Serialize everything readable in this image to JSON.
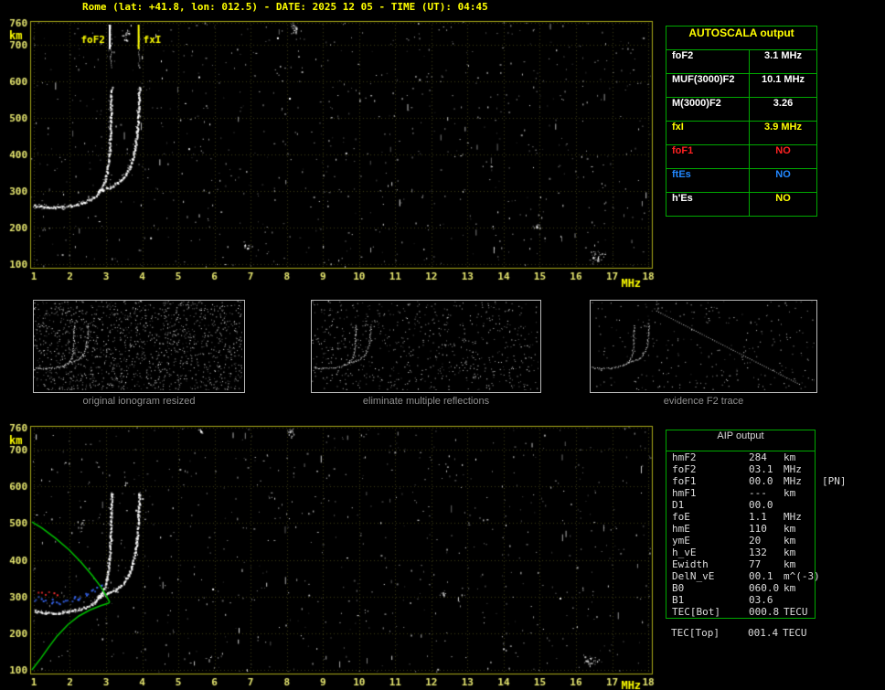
{
  "title": "Rome (lat: +41.8, lon: 012.5) - DATE: 2025 12 05 - TIME (UT): 04:45",
  "colors": {
    "accent_yellow": "#ffff00",
    "table_green": "#00a800",
    "caption_gray": "#8f8f8f",
    "status_no_red": "#ff2222",
    "status_no_blue": "#2288ff"
  },
  "autoscala": {
    "title": "AUTOSCALA output",
    "rows": [
      {
        "param": "foF2",
        "value": "3.1 MHz",
        "param_color": "#ffffff",
        "value_color": "#ffffff"
      },
      {
        "param": "MUF(3000)F2",
        "value": "10.1 MHz",
        "param_color": "#ffffff",
        "value_color": "#ffffff"
      },
      {
        "param": "M(3000)F2",
        "value": "3.26",
        "param_color": "#ffffff",
        "value_color": "#ffffff"
      },
      {
        "param": "fxI",
        "value": "3.9 MHz",
        "param_color": "#ffff00",
        "value_color": "#ffff00"
      },
      {
        "param": "foF1",
        "value": "NO",
        "param_color": "#ff2222",
        "value_color": "#ff2222"
      },
      {
        "param": "ftEs",
        "value": "NO",
        "param_color": "#2288ff",
        "value_color": "#2288ff"
      },
      {
        "param": "h'Es",
        "value": "NO",
        "param_color": "#ffffff",
        "value_color": "#ffff00"
      }
    ]
  },
  "aip": {
    "title": "AIP output",
    "rows": [
      {
        "param": "hmF2",
        "value": "284",
        "unit": "km",
        "note": ""
      },
      {
        "param": "foF2",
        "value": "03.1",
        "unit": "MHz",
        "note": ""
      },
      {
        "param": "foF1",
        "value": "00.0",
        "unit": "MHz",
        "note": "[PN]"
      },
      {
        "param": "hmF1",
        "value": "---",
        "unit": "km",
        "note": ""
      },
      {
        "param": "D1",
        "value": "00.0",
        "unit": "",
        "note": ""
      },
      {
        "param": "foE",
        "value": "1.1",
        "unit": "MHz",
        "note": ""
      },
      {
        "param": "hmE",
        "value": "110",
        "unit": "km",
        "note": ""
      },
      {
        "param": "ymE",
        "value": "20",
        "unit": "km",
        "note": ""
      },
      {
        "param": "h_vE",
        "value": "132",
        "unit": "km",
        "note": ""
      },
      {
        "param": "Ewidth",
        "value": "77",
        "unit": "km",
        "note": ""
      },
      {
        "param": "DelN_vE",
        "value": "00.1",
        "unit": "m^(-3)",
        "note": ""
      },
      {
        "param": "B0",
        "value": "060.0",
        "unit": "km",
        "note": ""
      },
      {
        "param": "B1",
        "value": "03.6",
        "unit": "",
        "note": ""
      },
      {
        "param": "TEC[Bot]",
        "value": "000.8",
        "unit": "TECU",
        "note": ""
      },
      {
        "param": "TEC[Top]",
        "value": "001.4",
        "unit": "TECU",
        "note": ""
      }
    ]
  },
  "thumbnails": {
    "captions": [
      "original ionogram resized",
      "eliminate multiple reflections",
      "evidence F2 trace"
    ],
    "xlim": [
      0.9,
      12.5
    ],
    "ylim": [
      90,
      765
    ],
    "items": [
      {
        "seed": 11,
        "noise": 1500,
        "diagonal": false
      },
      {
        "seed": 22,
        "noise": 720,
        "diagonal": false
      },
      {
        "seed": 33,
        "noise": 300,
        "diagonal": true
      }
    ],
    "diagonal": [
      [
        4.3,
        690
      ],
      [
        11.8,
        130
      ]
    ]
  },
  "chart_data": [
    {
      "type": "scatter",
      "name": "main-ionogram",
      "title": "recorded ionogram with autoscaled trace",
      "xlabel": "MHz",
      "ylabel": "km",
      "xlim": [
        0.9,
        18.1
      ],
      "ylim": [
        90,
        765
      ],
      "x_ticks": [
        1,
        2,
        3,
        4,
        5,
        6,
        7,
        8,
        9,
        10,
        11,
        12,
        13,
        14,
        15,
        16,
        17,
        18
      ],
      "y_ticks": [
        100,
        200,
        300,
        400,
        500,
        600,
        700,
        760
      ],
      "grid": true,
      "border_color": "#a8a818",
      "grid_color": "#3c3c14",
      "tick_color": "#e8e870",
      "axis_label_color": "#ffff00",
      "markers": [
        {
          "label": "foF2",
          "freq": 3.1,
          "line_color": "#ffffff",
          "label_color": "#ffff00",
          "side": "left"
        },
        {
          "label": "fxI",
          "freq": 3.9,
          "line_color": "#ffff00",
          "label_color": "#ffff00",
          "side": "right"
        }
      ],
      "series": [
        {
          "name": "F2-ordinary-trace",
          "style": "trace",
          "color": "#ffffff",
          "points": [
            [
              1.0,
              262
            ],
            [
              1.2,
              258
            ],
            [
              1.45,
              256
            ],
            [
              1.7,
              257
            ],
            [
              1.95,
              260
            ],
            [
              2.2,
              265
            ],
            [
              2.45,
              273
            ],
            [
              2.65,
              284
            ],
            [
              2.8,
              298
            ],
            [
              2.92,
              318
            ],
            [
              3.0,
              345
            ],
            [
              3.05,
              378
            ],
            [
              3.09,
              420
            ],
            [
              3.11,
              468
            ],
            [
              3.12,
              515
            ],
            [
              3.13,
              558
            ],
            [
              3.14,
              588
            ]
          ]
        },
        {
          "name": "F2-extraordinary-trace",
          "style": "trace",
          "color": "#ffffff",
          "points": [
            [
              2.75,
              300
            ],
            [
              2.95,
              306
            ],
            [
              3.15,
              314
            ],
            [
              3.35,
              326
            ],
            [
              3.5,
              341
            ],
            [
              3.62,
              362
            ],
            [
              3.72,
              390
            ],
            [
              3.8,
              426
            ],
            [
              3.85,
              468
            ],
            [
              3.88,
              515
            ],
            [
              3.9,
              558
            ],
            [
              3.91,
              588
            ]
          ]
        },
        {
          "name": "o-mode-spread",
          "style": "vdots",
          "color": "#dddddd",
          "points": [
            [
              3.13,
              640
            ],
            [
              3.13,
              758
            ]
          ]
        },
        {
          "name": "x-mode-spread",
          "style": "vdots",
          "color": "#dddddd",
          "points": [
            [
              3.9,
              640
            ],
            [
              3.9,
              758
            ]
          ]
        }
      ],
      "noise": {
        "seed": 20251205,
        "count": 780,
        "streaks": 50,
        "clusters": [
          {
            "f": 8.2,
            "km": 742,
            "n": 26,
            "sx": 4,
            "sy": 8
          },
          {
            "f": 3.55,
            "km": 728,
            "n": 20,
            "sx": 6,
            "sy": 10
          },
          {
            "f": 16.6,
            "km": 120,
            "n": 34,
            "sx": 10,
            "sy": 9
          },
          {
            "f": 14.9,
            "km": 205,
            "n": 10,
            "sx": 5,
            "sy": 5
          },
          {
            "f": 6.9,
            "km": 150,
            "n": 12,
            "sx": 6,
            "sy": 6
          }
        ]
      }
    },
    {
      "type": "scatter",
      "name": "profile-ionogram",
      "title": "ionogram with restored electron density profile",
      "xlabel": "MHz",
      "ylabel": "km",
      "xlim": [
        0.9,
        18.1
      ],
      "ylim": [
        90,
        765
      ],
      "x_ticks": [
        1,
        2,
        3,
        4,
        5,
        6,
        7,
        8,
        9,
        10,
        11,
        12,
        13,
        14,
        15,
        16,
        17,
        18
      ],
      "y_ticks": [
        100,
        200,
        300,
        400,
        500,
        600,
        700,
        760
      ],
      "grid": true,
      "border_color": "#a8a818",
      "grid_color": "#3c3c14",
      "tick_color": "#e8e870",
      "axis_label_color": "#ffff00",
      "markers": [],
      "series": [
        {
          "name": "F2-ordinary-trace",
          "style": "trace",
          "color": "#ffffff",
          "points": [
            [
              1.0,
              262
            ],
            [
              1.2,
              258
            ],
            [
              1.45,
              256
            ],
            [
              1.7,
              257
            ],
            [
              1.95,
              260
            ],
            [
              2.2,
              265
            ],
            [
              2.45,
              273
            ],
            [
              2.65,
              284
            ],
            [
              2.8,
              298
            ],
            [
              2.92,
              318
            ],
            [
              3.0,
              345
            ],
            [
              3.05,
              378
            ],
            [
              3.09,
              420
            ],
            [
              3.11,
              468
            ],
            [
              3.12,
              515
            ],
            [
              3.13,
              558
            ],
            [
              3.14,
              588
            ]
          ]
        },
        {
          "name": "F2-extraordinary-trace",
          "style": "trace",
          "color": "#ffffff",
          "points": [
            [
              2.75,
              300
            ],
            [
              2.95,
              306
            ],
            [
              3.15,
              314
            ],
            [
              3.35,
              326
            ],
            [
              3.5,
              341
            ],
            [
              3.62,
              362
            ],
            [
              3.72,
              390
            ],
            [
              3.8,
              426
            ],
            [
              3.85,
              468
            ],
            [
              3.88,
              515
            ],
            [
              3.9,
              558
            ],
            [
              3.91,
              588
            ]
          ]
        },
        {
          "name": "scaled-trace-points",
          "style": "dots",
          "color": "#3a6cff",
          "per": 3,
          "points": [
            [
              1.05,
              296
            ],
            [
              1.25,
              292
            ],
            [
              1.45,
              289
            ],
            [
              1.65,
              288
            ],
            [
              1.85,
              290
            ],
            [
              2.05,
              294
            ],
            [
              2.25,
              300
            ],
            [
              2.45,
              308
            ],
            [
              2.65,
              318
            ],
            [
              2.8,
              330
            ]
          ]
        },
        {
          "name": "flagged-points",
          "style": "dots",
          "color": "#ff3030",
          "per": 2,
          "points": [
            [
              1.15,
              306
            ],
            [
              1.35,
              309
            ],
            [
              1.6,
              304
            ]
          ]
        },
        {
          "name": "electron-density-profile-bottomside",
          "style": "line",
          "color": "#00c000",
          "points": [
            [
              0.95,
              100
            ],
            [
              1.05,
              113
            ],
            [
              1.2,
              132
            ],
            [
              1.4,
              160
            ],
            [
              1.65,
              193
            ],
            [
              1.95,
              224
            ],
            [
              2.25,
              247
            ],
            [
              2.55,
              263
            ],
            [
              2.85,
              275
            ],
            [
              3.05,
              281
            ],
            [
              3.1,
              284
            ]
          ]
        },
        {
          "name": "electron-density-profile-topside",
          "style": "line",
          "color": "#00c000",
          "points": [
            [
              3.1,
              284
            ],
            [
              3.0,
              303
            ],
            [
              2.85,
              327
            ],
            [
              2.62,
              357
            ],
            [
              2.32,
              392
            ],
            [
              1.98,
              427
            ],
            [
              1.6,
              459
            ],
            [
              1.22,
              487
            ],
            [
              0.95,
              503
            ]
          ]
        }
      ],
      "noise": {
        "seed": 445,
        "count": 700,
        "streaks": 45,
        "clusters": [
          {
            "f": 8.1,
            "km": 748,
            "n": 18,
            "sx": 4,
            "sy": 6
          },
          {
            "f": 5.6,
            "km": 752,
            "n": 10,
            "sx": 3,
            "sy": 4
          },
          {
            "f": 16.4,
            "km": 128,
            "n": 26,
            "sx": 9,
            "sy": 8
          },
          {
            "f": 12.3,
            "km": 310,
            "n": 8,
            "sx": 4,
            "sy": 4
          },
          {
            "f": 2.3,
            "km": 500,
            "n": 10,
            "sx": 5,
            "sy": 14
          }
        ]
      }
    }
  ]
}
